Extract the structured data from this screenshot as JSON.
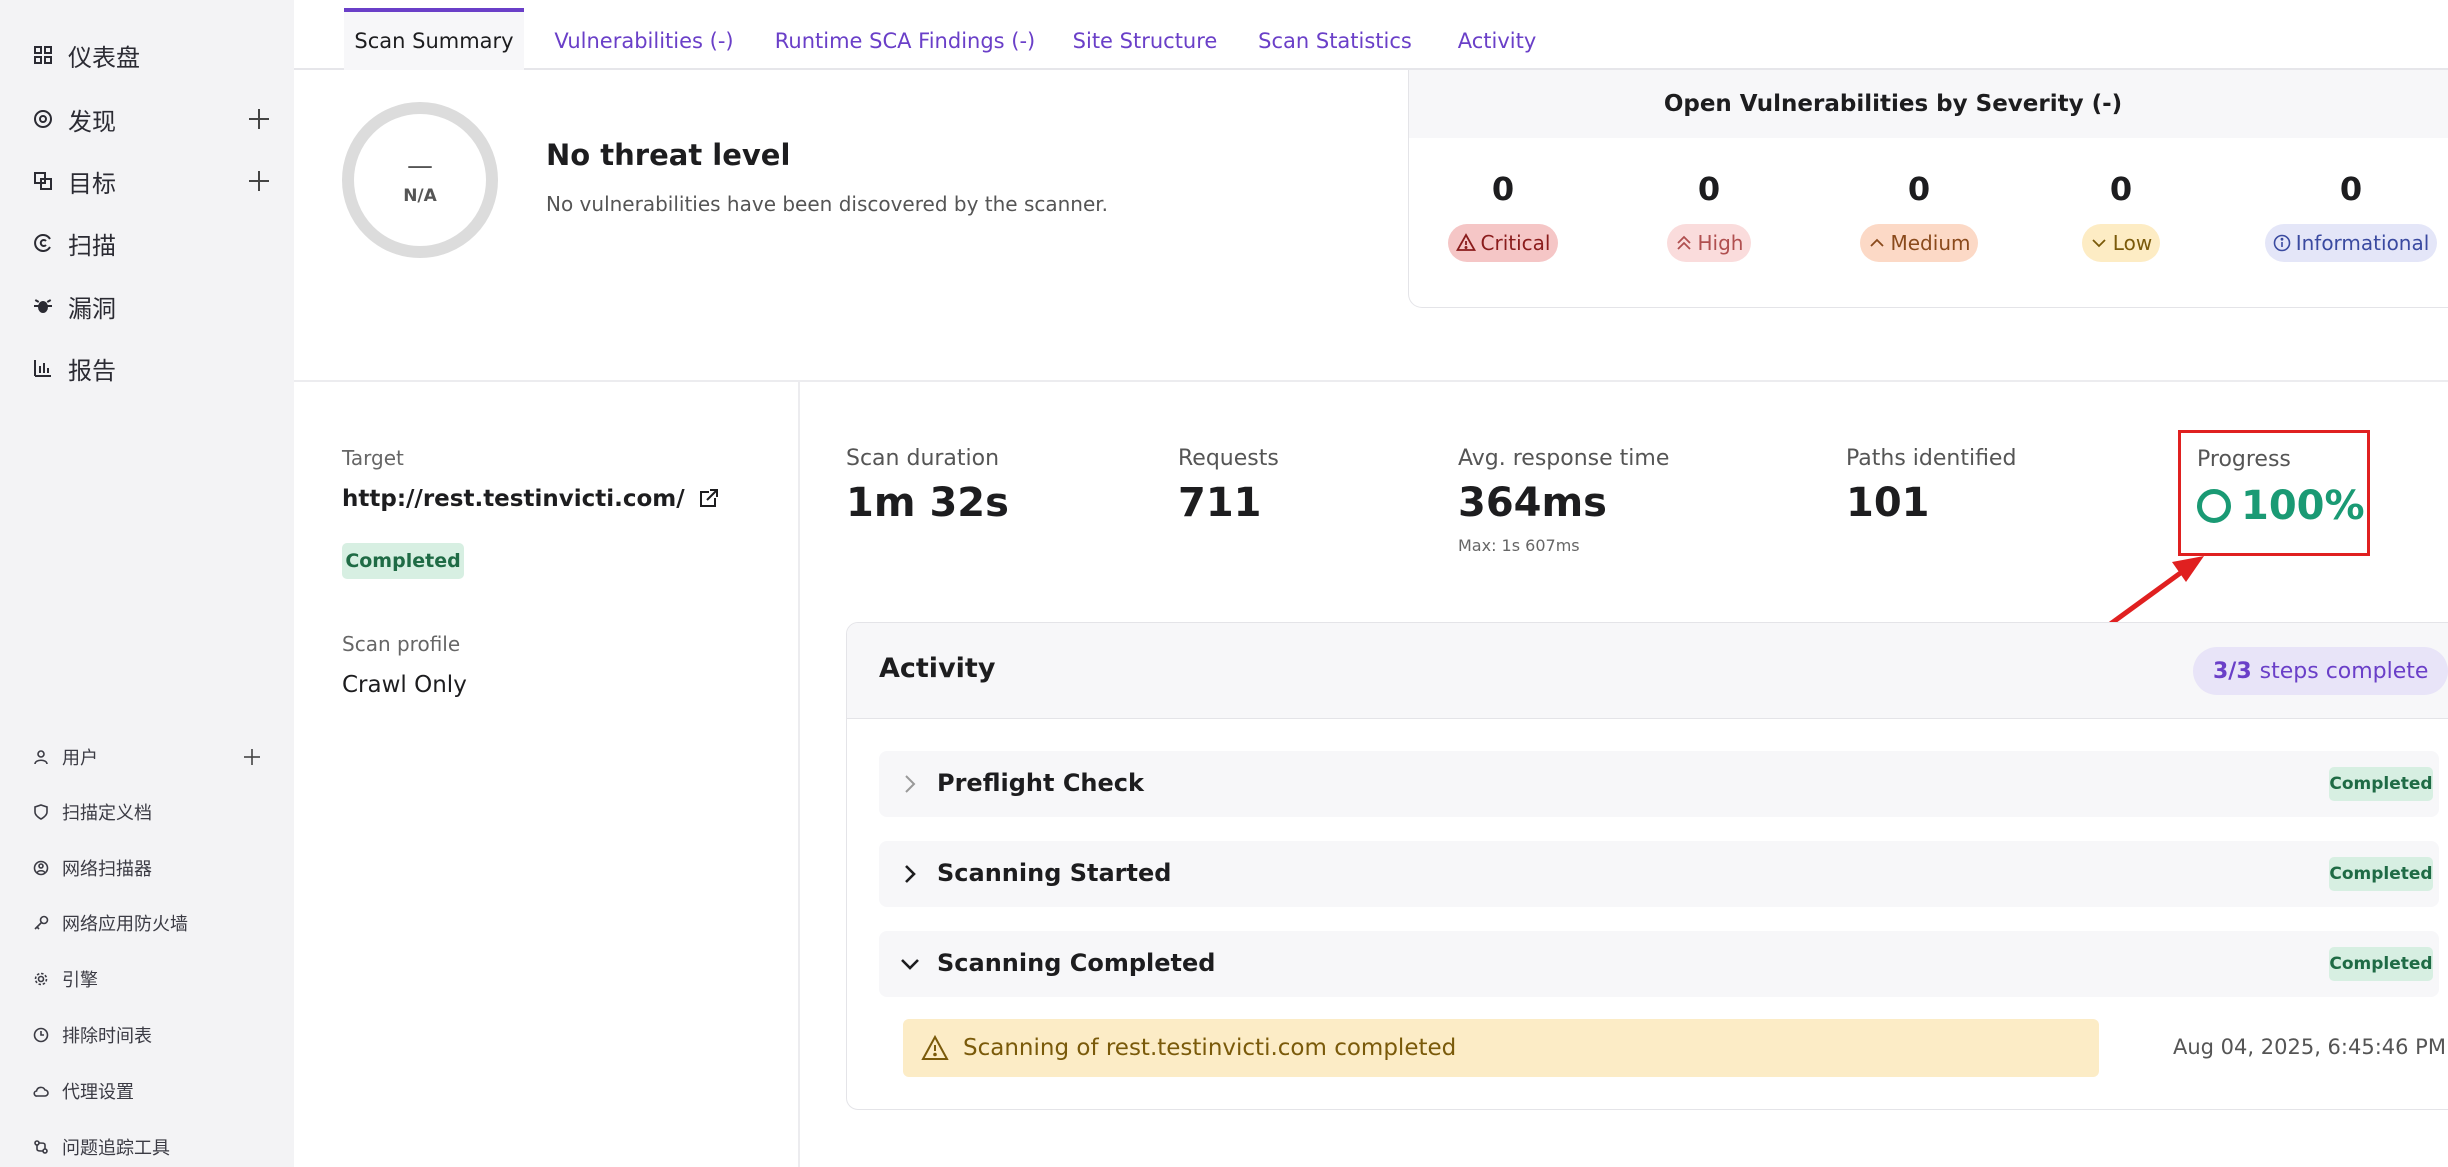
{
  "sidebar": {
    "main_items": [
      {
        "label": "仪表盘",
        "icon": "dashboard-icon"
      },
      {
        "label": "发现",
        "icon": "discovery-icon"
      },
      {
        "label": "目标",
        "icon": "targets-icon"
      },
      {
        "label": "扫描",
        "icon": "scans-icon"
      },
      {
        "label": "漏洞",
        "icon": "bug-icon"
      },
      {
        "label": "报告",
        "icon": "reports-icon"
      }
    ],
    "bottom_items": [
      {
        "label": "用户",
        "icon": "user-icon"
      },
      {
        "label": "扫描定义档",
        "icon": "shield-icon"
      },
      {
        "label": "网络扫描器",
        "icon": "scanner-icon"
      },
      {
        "label": "网络应用防火墙",
        "icon": "key-icon"
      },
      {
        "label": "引擎",
        "icon": "gear-icon"
      },
      {
        "label": "排除时间表",
        "icon": "clock-icon"
      },
      {
        "label": "代理设置",
        "icon": "cloud-icon"
      },
      {
        "label": "问题追踪工具",
        "icon": "tracker-icon"
      }
    ]
  },
  "tabs": [
    {
      "label": "Scan Summary",
      "active": true
    },
    {
      "label": "Vulnerabilities (-)",
      "active": false
    },
    {
      "label": "Runtime SCA Findings (-)",
      "active": false
    },
    {
      "label": "Site Structure",
      "active": false
    },
    {
      "label": "Scan Statistics",
      "active": false
    },
    {
      "label": "Activity",
      "active": false
    }
  ],
  "threat": {
    "ring_dash": "—",
    "ring_label": "N/A",
    "title": "No threat level",
    "description": "No vulnerabilities have been discovered by the scanner."
  },
  "severity": {
    "title": "Open Vulnerabilities by Severity (-)",
    "items": [
      {
        "label": "Critical",
        "count": "0",
        "bg": "#f5c6c6",
        "fg": "#8a1c1c",
        "icon": "warning-triangle-icon"
      },
      {
        "label": "High",
        "count": "0",
        "bg": "#fadcdc",
        "fg": "#b05050",
        "icon": "double-chevron-up-icon"
      },
      {
        "label": "Medium",
        "count": "0",
        "bg": "#fcd9c6",
        "fg": "#8a4a1c",
        "icon": "chevron-up-icon"
      },
      {
        "label": "Low",
        "count": "0",
        "bg": "#fdecc4",
        "fg": "#7a5a0a",
        "icon": "chevron-down-icon"
      },
      {
        "label": "Informational",
        "count": "0",
        "bg": "#e4e6f8",
        "fg": "#3a4aa0",
        "icon": "info-circle-icon"
      }
    ]
  },
  "target": {
    "label": "Target",
    "url": "http://rest.testinvicti.com/",
    "status": "Completed",
    "profile_label": "Scan profile",
    "profile_value": "Crawl Only"
  },
  "stats": {
    "duration_label": "Scan duration",
    "duration_value": "1m 32s",
    "requests_label": "Requests",
    "requests_value": "711",
    "response_label": "Avg. response time",
    "response_value": "364ms",
    "response_max": "Max: 1s 607ms",
    "paths_label": "Paths identified",
    "paths_value": "101",
    "progress_label": "Progress",
    "progress_value": "100%"
  },
  "activity": {
    "title": "Activity",
    "steps_count": "3/3",
    "steps_text": "steps complete",
    "steps": [
      {
        "title": "Preflight Check",
        "status": "Completed",
        "expanded": false
      },
      {
        "title": "Scanning Started",
        "status": "Completed",
        "expanded": false
      },
      {
        "title": "Scanning Completed",
        "status": "Completed",
        "expanded": true
      }
    ],
    "notice_text": "Scanning of rest.testinvicti.com completed",
    "notice_time": "Aug 04, 2025, 6:45:46 PM"
  },
  "colors": {
    "accent": "#6a3fc8",
    "success": "#1a9a74",
    "annotation": "#e02020"
  }
}
